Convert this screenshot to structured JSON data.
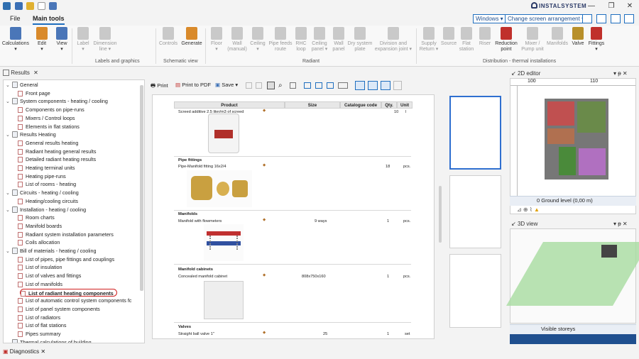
{
  "app": {
    "brand": "INSTALSYSTEM",
    "window_controls": [
      "—",
      "❐",
      "✕"
    ]
  },
  "menu": {
    "file": "File",
    "main_tools": "Main tools",
    "windows": "Windows ▾",
    "screen_arrangement": "Change screen arrangement ▾"
  },
  "ribbon": {
    "buttons": [
      {
        "label": "Calculations\n▾",
        "color": "#4a76b8"
      },
      {
        "label": "Edit\n▾",
        "color": "#d98a2b"
      },
      {
        "label": "View\n▾",
        "color": "#4a76b8"
      },
      {
        "label": "Label\n▾",
        "color": "#9aa7b8"
      },
      {
        "label": "Dimension\nline ▾",
        "color": "#9aa7b8"
      },
      {
        "label": "Controls",
        "color": "#9aa7b8"
      },
      {
        "label": "Generate",
        "color": "#d98a2b"
      },
      {
        "label": "Floor\n▾",
        "color": "#9aa7b8"
      },
      {
        "label": "Wall\n(manual)",
        "color": "#9aa7b8"
      },
      {
        "label": "Ceiling\n▾",
        "color": "#9aa7b8"
      },
      {
        "label": "Pipe feeds\nroute",
        "color": "#9aa7b8"
      },
      {
        "label": "RHC\nloop",
        "color": "#9aa7b8"
      },
      {
        "label": "Ceiling\npanel ▾",
        "color": "#9aa7b8"
      },
      {
        "label": "Wall\npanel",
        "color": "#9aa7b8"
      },
      {
        "label": "Dry system\nplate",
        "color": "#9aa7b8"
      },
      {
        "label": "Division and\nexpansion joint ▾",
        "color": "#9aa7b8"
      },
      {
        "label": "Supply\nReturn ▾",
        "color": "#9aa7b8"
      },
      {
        "label": "Source",
        "color": "#9aa7b8"
      },
      {
        "label": "Flat\nstation",
        "color": "#9aa7b8"
      },
      {
        "label": "Riser",
        "color": "#9aa7b8"
      },
      {
        "label": "Reduction\npoint",
        "color": "#c0302b"
      },
      {
        "label": "Mixer /\nPump unit",
        "color": "#9aa7b8"
      },
      {
        "label": "Manifolds",
        "color": "#9aa7b8"
      },
      {
        "label": "Valve",
        "color": "#b8902b"
      },
      {
        "label": "Fittings\n▾",
        "color": "#c0302b"
      }
    ],
    "groups": [
      "Labels and graphics",
      "Schematic view",
      "Radiant",
      "Distribution - thermal installations"
    ]
  },
  "results_panel": {
    "title": "Results",
    "tree": [
      {
        "level": 0,
        "label": "General",
        "type": "folder"
      },
      {
        "level": 1,
        "label": "Front page",
        "type": "leaf"
      },
      {
        "level": 0,
        "label": "System components - heating / cooling",
        "type": "folder"
      },
      {
        "level": 1,
        "label": "Components on pipe-runs",
        "type": "leaf"
      },
      {
        "level": 1,
        "label": "Mixers / Control loops",
        "type": "leaf"
      },
      {
        "level": 1,
        "label": "Elements in flat stations",
        "type": "leaf"
      },
      {
        "level": 0,
        "label": "Results Heating",
        "type": "folder"
      },
      {
        "level": 1,
        "label": "General results heating",
        "type": "leaf"
      },
      {
        "level": 1,
        "label": "Radiant heating general results",
        "type": "leaf"
      },
      {
        "level": 1,
        "label": "Detailed radiant heating results",
        "type": "leaf"
      },
      {
        "level": 1,
        "label": "Heating terminal units",
        "type": "leaf"
      },
      {
        "level": 1,
        "label": "Heating pipe-runs",
        "type": "leaf"
      },
      {
        "level": 1,
        "label": "List of rooms - heating",
        "type": "leaf"
      },
      {
        "level": 0,
        "label": "Circuits - heating / cooling",
        "type": "folder"
      },
      {
        "level": 1,
        "label": "Heating/cooling circuits",
        "type": "leaf"
      },
      {
        "level": 0,
        "label": "Installation - heating / cooling",
        "type": "folder"
      },
      {
        "level": 1,
        "label": "Room charts",
        "type": "leaf"
      },
      {
        "level": 1,
        "label": "Manifold boards",
        "type": "leaf"
      },
      {
        "level": 1,
        "label": "Radiant system installation parameters",
        "type": "leaf"
      },
      {
        "level": 1,
        "label": "Coils allocation",
        "type": "leaf"
      },
      {
        "level": 0,
        "label": "Bill of materials - heating / cooling",
        "type": "folder"
      },
      {
        "level": 1,
        "label": "List of pipes, pipe fittings and couplings",
        "type": "leaf"
      },
      {
        "level": 1,
        "label": "List of insulation",
        "type": "leaf"
      },
      {
        "level": 1,
        "label": "List of valves and fittings",
        "type": "leaf"
      },
      {
        "level": 1,
        "label": "List of manifolds",
        "type": "leaf"
      },
      {
        "level": 1,
        "label": "List of radiant heating components",
        "type": "leaf",
        "selected": true
      },
      {
        "level": 1,
        "label": "List of automatic control system components fc",
        "type": "leaf"
      },
      {
        "level": 1,
        "label": "List of panel system components",
        "type": "leaf"
      },
      {
        "level": 1,
        "label": "List of radiators",
        "type": "leaf"
      },
      {
        "level": 1,
        "label": "List of flat stations",
        "type": "leaf"
      },
      {
        "level": 1,
        "label": "Pipes summary",
        "type": "leaf"
      },
      {
        "level": 0,
        "label": "Thermal calculations of building",
        "type": "folder"
      }
    ]
  },
  "doc_toolbar": {
    "print": "Print",
    "print_pdf": "Print to PDF",
    "save": "Save"
  },
  "document": {
    "columns": [
      "Product",
      "Size",
      "Catalogue code",
      "Qty.",
      "Unit"
    ],
    "rows": [
      {
        "section": "",
        "product": "Screed additive 2.5 liter/m3 of screed",
        "size": "",
        "qty": "10",
        "unit": "l"
      },
      {
        "section": "Pipe fittings",
        "product": "Pipe-Manifold fitting 16x2/4",
        "size": "",
        "qty": "18",
        "unit": "pcs."
      },
      {
        "section": "Manifolds",
        "product": "Manifold with flowmeters",
        "size": "9 ways",
        "qty": "1",
        "unit": "pcs."
      },
      {
        "section": "Manifold cabinets",
        "product": "Concealed manifold cabinet",
        "size": "808x750x160",
        "qty": "1",
        "unit": "pcs."
      },
      {
        "section": "Valves",
        "product": "Straight ball valve 1\"",
        "size": "25",
        "qty": "1",
        "unit": "set"
      }
    ]
  },
  "editor_2d": {
    "title": "2D editor",
    "ruler_ticks": [
      "100",
      "110"
    ],
    "level_select": "0 Ground  level (0,00 m)"
  },
  "view_3d": {
    "title": "3D view",
    "storeys_select": "Visible storeys"
  },
  "bottom": {
    "diagnostics": "Diagnostics"
  }
}
